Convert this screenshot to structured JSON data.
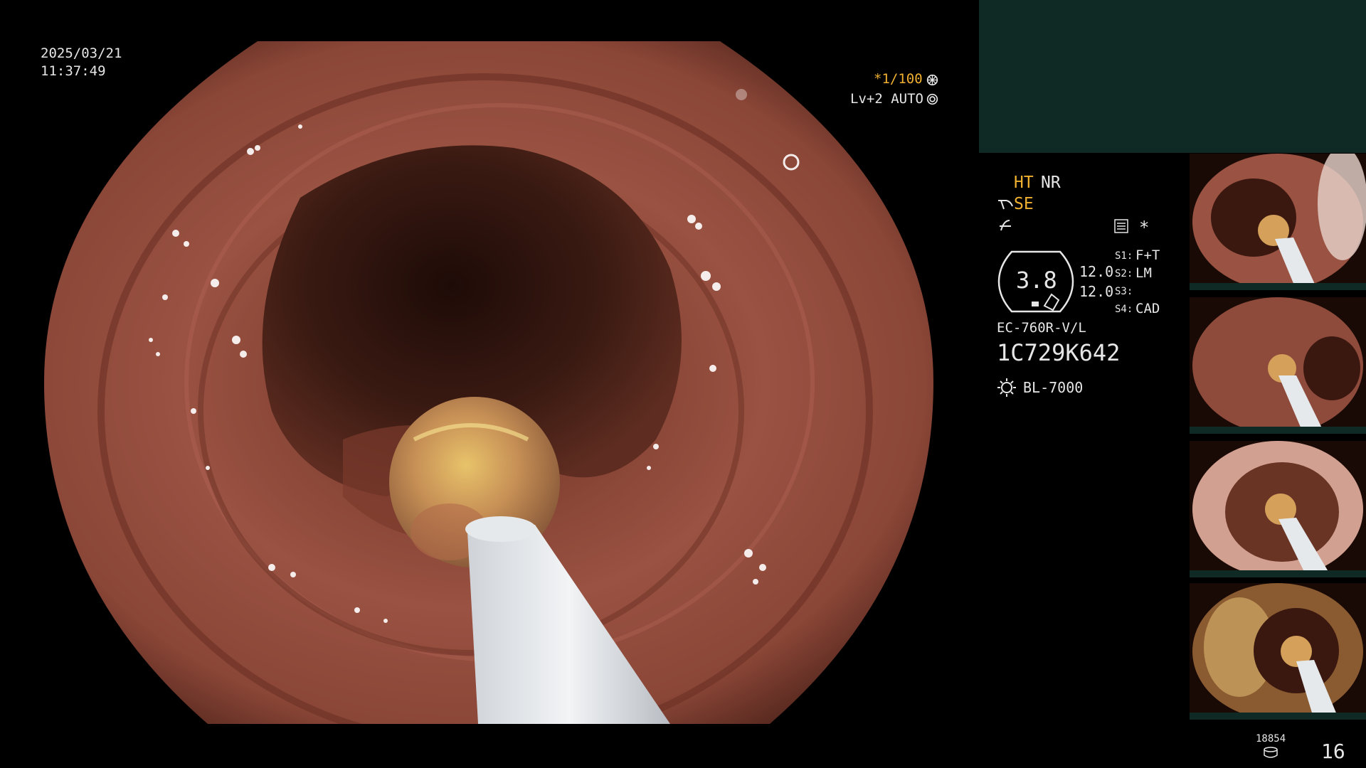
{
  "overlay": {
    "date": "2025/03/21",
    "time": "11:37:49",
    "shutter": "*1/100",
    "enhancement": "Lv+2 AUTO"
  },
  "info_panel": {
    "ht_label": "HT",
    "nr_label": "NR",
    "se_label": "SE",
    "gauge_value": "3.8",
    "value_top": "12.0",
    "value_bottom": "12.0",
    "s1": "S1:",
    "s1_value": "F+T",
    "s2": "S2:",
    "s2_value": "LM",
    "s3": "S3:",
    "s3_value": "",
    "s4": "S4:",
    "s4_value": "CAD",
    "scope_model": "EC-760R-V/L",
    "serial": "1C729K642",
    "light_source": "BL-7000",
    "asterisk": "*"
  },
  "thumbnails": [
    {
      "name": "capture-1"
    },
    {
      "name": "capture-2"
    },
    {
      "name": "capture-3"
    },
    {
      "name": "capture-4"
    }
  ],
  "footer": {
    "counter_small": "18854",
    "page_number": "16"
  },
  "colors": {
    "panel_teal": "#0f2a25",
    "mucosa": "#8e4a3b",
    "lumen": "#2a120c",
    "highlight_yellow": "#f0b030"
  }
}
